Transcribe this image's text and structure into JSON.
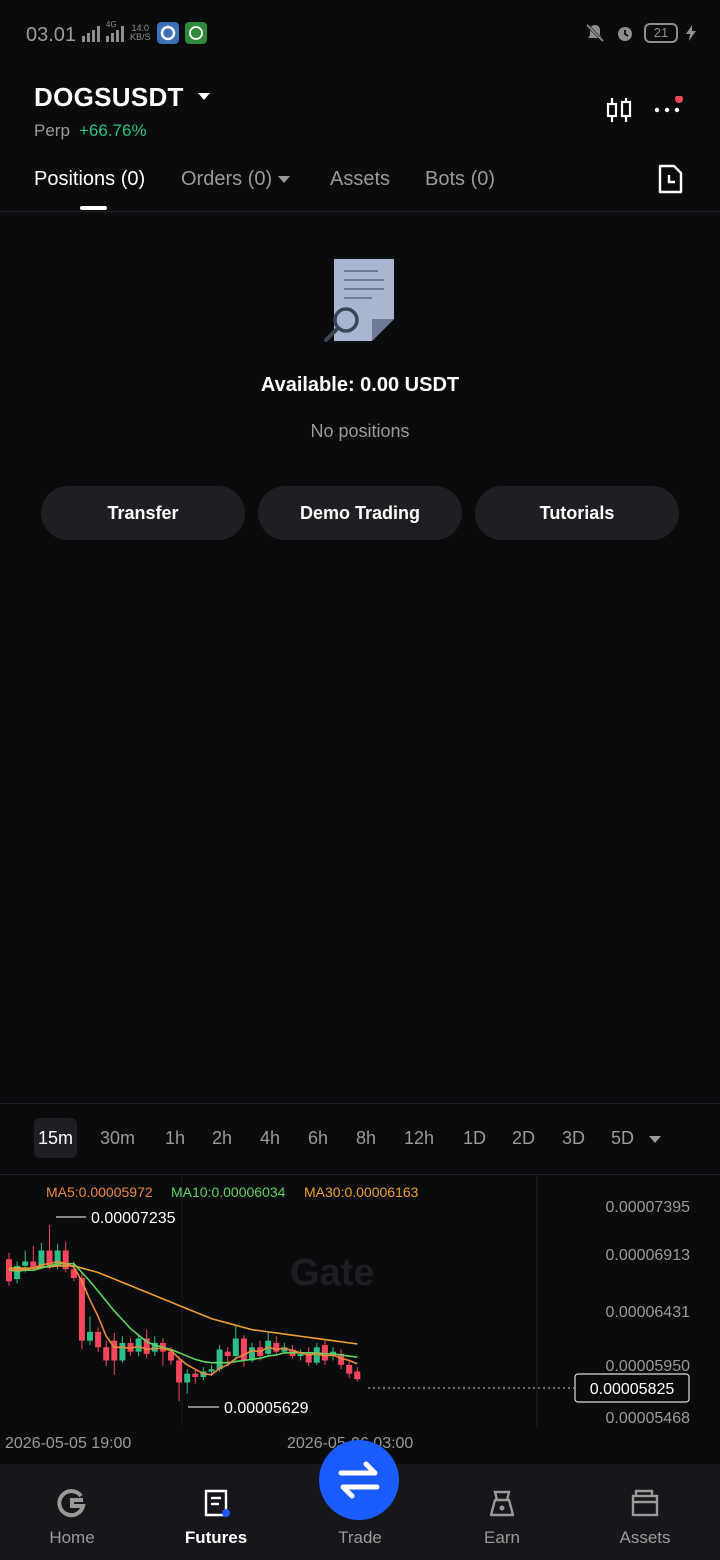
{
  "status_bar": {
    "time": "03.01",
    "net_speed_value": "14.0",
    "net_speed_unit": "KB/S",
    "battery": "21",
    "network_label": "4G"
  },
  "header": {
    "symbol": "DOGSUSDT",
    "contract_type": "Perp",
    "change": "+66.76%",
    "change_color": "#2ec27e",
    "icons": [
      "candlestick-icon",
      "more-icon",
      "history-icon"
    ]
  },
  "tabs": [
    {
      "label": "Positions (0)",
      "active": true
    },
    {
      "label": "Orders (0)",
      "active": false
    },
    {
      "label": "Assets",
      "active": false
    },
    {
      "label": "Bots (0)",
      "active": false
    }
  ],
  "empty_state": {
    "available": "Available: 0.00 USDT",
    "message": "No positions"
  },
  "actions": [
    {
      "label": "Transfer"
    },
    {
      "label": "Demo Trading"
    },
    {
      "label": "Tutorials"
    }
  ],
  "chart": {
    "intervals": [
      "15m",
      "30m",
      "1h",
      "2h",
      "4h",
      "6h",
      "8h",
      "12h",
      "1D",
      "2D",
      "3D",
      "5D"
    ],
    "active_interval": "15m",
    "ma5": "MA5:0.00005972",
    "ma10": "MA10:0.00006034",
    "ma30": "MA30:0.00006163",
    "ma5_color": "#f0883e",
    "ma10_color": "#5fd35f",
    "ma30_color": "#f0a030",
    "watermark": "Gate",
    "high_label": "0.00007235",
    "low_label": "0.00005629",
    "current_price": "0.00005825",
    "y_ticks": [
      "0.00007395",
      "0.00006913",
      "0.00006431",
      "0.00005950",
      "0.00005468"
    ],
    "x_ticks": [
      "2026-05-05 19:00",
      "2026-05-06 03:00"
    ],
    "up_color": "#2ebd85",
    "down_color": "#f6465d"
  },
  "chart_data": {
    "type": "candlestick",
    "ylim": [
      5.468e-05,
      7.395e-05
    ],
    "candles": [
      {
        "o": 6.92e-05,
        "c": 6.72e-05,
        "h": 6.98e-05,
        "l": 6.68e-05
      },
      {
        "o": 6.74e-05,
        "c": 6.86e-05,
        "h": 6.9e-05,
        "l": 6.7e-05
      },
      {
        "o": 6.86e-05,
        "c": 6.9e-05,
        "h": 7e-05,
        "l": 6.8e-05
      },
      {
        "o": 6.9e-05,
        "c": 6.85e-05,
        "h": 7.04e-05,
        "l": 6.82e-05
      },
      {
        "o": 6.85e-05,
        "c": 7e-05,
        "h": 7.07e-05,
        "l": 6.84e-05
      },
      {
        "o": 7e-05,
        "c": 6.86e-05,
        "h": 7.23e-05,
        "l": 6.83e-05
      },
      {
        "o": 6.86e-05,
        "c": 7e-05,
        "h": 7.06e-05,
        "l": 6.83e-05
      },
      {
        "o": 7e-05,
        "c": 6.83e-05,
        "h": 7.08e-05,
        "l": 6.8e-05
      },
      {
        "o": 6.83e-05,
        "c": 6.75e-05,
        "h": 6.9e-05,
        "l": 6.72e-05
      },
      {
        "o": 6.75e-05,
        "c": 6.18e-05,
        "h": 6.8e-05,
        "l": 6.1e-05
      },
      {
        "o": 6.18e-05,
        "c": 6.26e-05,
        "h": 6.4e-05,
        "l": 6.14e-05
      },
      {
        "o": 6.26e-05,
        "c": 6.12e-05,
        "h": 6.3e-05,
        "l": 6.08e-05
      },
      {
        "o": 6.12e-05,
        "c": 6e-05,
        "h": 6.18e-05,
        "l": 5.95e-05
      },
      {
        "o": 6.18e-05,
        "c": 6e-05,
        "h": 6.25e-05,
        "l": 5.87e-05
      },
      {
        "o": 6e-05,
        "c": 6.16e-05,
        "h": 6.22e-05,
        "l": 5.98e-05
      },
      {
        "o": 6.16e-05,
        "c": 6.08e-05,
        "h": 6.2e-05,
        "l": 6.04e-05
      },
      {
        "o": 6.08e-05,
        "c": 6.2e-05,
        "h": 6.24e-05,
        "l": 6.04e-05
      },
      {
        "o": 6.2e-05,
        "c": 6.06e-05,
        "h": 6.28e-05,
        "l": 6.02e-05
      },
      {
        "o": 6.08e-05,
        "c": 6.16e-05,
        "h": 6.22e-05,
        "l": 6.04e-05
      },
      {
        "o": 6.16e-05,
        "c": 6.08e-05,
        "h": 6.2e-05,
        "l": 5.95e-05
      },
      {
        "o": 6.08e-05,
        "c": 6e-05,
        "h": 6.12e-05,
        "l": 5.96e-05
      },
      {
        "o": 6e-05,
        "c": 5.8e-05,
        "h": 6.04e-05,
        "l": 5.63e-05
      },
      {
        "o": 5.8e-05,
        "c": 5.88e-05,
        "h": 5.92e-05,
        "l": 5.7e-05
      },
      {
        "o": 5.88e-05,
        "c": 5.85e-05,
        "h": 5.92e-05,
        "l": 5.79e-05
      },
      {
        "o": 5.85e-05,
        "c": 5.9e-05,
        "h": 5.94e-05,
        "l": 5.82e-05
      },
      {
        "o": 5.9e-05,
        "c": 5.92e-05,
        "h": 5.96e-05,
        "l": 5.86e-05
      },
      {
        "o": 5.92e-05,
        "c": 6.1e-05,
        "h": 6.14e-05,
        "l": 5.9e-05
      },
      {
        "o": 6.08e-05,
        "c": 6.04e-05,
        "h": 6.12e-05,
        "l": 5.96e-05
      },
      {
        "o": 6.04e-05,
        "c": 6.2e-05,
        "h": 6.32e-05,
        "l": 6e-05
      },
      {
        "o": 6.2e-05,
        "c": 6e-05,
        "h": 6.23e-05,
        "l": 5.94e-05
      },
      {
        "o": 6e-05,
        "c": 6.12e-05,
        "h": 6.16e-05,
        "l": 5.98e-05
      },
      {
        "o": 6.12e-05,
        "c": 6.04e-05,
        "h": 6.18e-05,
        "l": 6e-05
      },
      {
        "o": 6.06e-05,
        "c": 6.18e-05,
        "h": 6.26e-05,
        "l": 6.03e-05
      },
      {
        "o": 6.16e-05,
        "c": 6.08e-05,
        "h": 6.22e-05,
        "l": 6.04e-05
      },
      {
        "o": 6.08e-05,
        "c": 6.12e-05,
        "h": 6.16e-05,
        "l": 6.06e-05
      },
      {
        "o": 6.1e-05,
        "c": 6.04e-05,
        "h": 6.14e-05,
        "l": 6.02e-05
      },
      {
        "o": 6.04e-05,
        "c": 6.06e-05,
        "h": 6.1e-05,
        "l": 6e-05
      },
      {
        "o": 6.06e-05,
        "c": 5.98e-05,
        "h": 6.12e-05,
        "l": 5.95e-05
      },
      {
        "o": 5.98e-05,
        "c": 6.12e-05,
        "h": 6.16e-05,
        "l": 5.96e-05
      },
      {
        "o": 6.14e-05,
        "c": 6e-05,
        "h": 6.18e-05,
        "l": 5.96e-05
      },
      {
        "o": 6.04e-05,
        "c": 6.08e-05,
        "h": 6.12e-05,
        "l": 6e-05
      },
      {
        "o": 6.06e-05,
        "c": 5.96e-05,
        "h": 6.1e-05,
        "l": 5.92e-05
      },
      {
        "o": 5.96e-05,
        "c": 5.88e-05,
        "h": 6e-05,
        "l": 5.84e-05
      },
      {
        "o": 5.9e-05,
        "c": 5.83e-05,
        "h": 5.94e-05,
        "l": 5.81e-05
      }
    ],
    "ma5": [
      6.83e-05,
      6.82e-05,
      6.83e-05,
      6.84e-05,
      6.87e-05,
      6.88e-05,
      6.9e-05,
      6.88e-05,
      6.85e-05,
      6.72e-05,
      6.55e-05,
      6.4e-05,
      6.22e-05,
      6.12e-05,
      6.12e-05,
      6.11e-05,
      6.13e-05,
      6.1e-05,
      6.11e-05,
      6.11e-05,
      6.09e-05,
      6.02e-05,
      5.96e-05,
      5.92e-05,
      5.88e-05,
      5.87e-05,
      5.93e-05,
      5.96e-05,
      6.02e-05,
      6.05e-05,
      6.09e-05,
      6.08e-05,
      6.12e-05,
      6.1e-05,
      6.11e-05,
      6.09e-05,
      6.07e-05,
      6.05e-05,
      6.06e-05,
      6.04e-05,
      6.05e-05,
      6.02e-05,
      6e-05,
      5.97e-05
    ],
    "ma10": [
      6.82e-05,
      6.81e-05,
      6.82e-05,
      6.82e-05,
      6.84e-05,
      6.86e-05,
      6.88e-05,
      6.88e-05,
      6.88e-05,
      6.8e-05,
      6.72e-05,
      6.63e-05,
      6.54e-05,
      6.45e-05,
      6.37e-05,
      6.29e-05,
      6.23e-05,
      6.17e-05,
      6.14e-05,
      6.12e-05,
      6.1e-05,
      6.07e-05,
      6.04e-05,
      6.01e-05,
      5.99e-05,
      5.98e-05,
      5.98e-05,
      5.98e-05,
      5.99e-05,
      6e-05,
      6.01e-05,
      6.02e-05,
      6.04e-05,
      6.05e-05,
      6.07e-05,
      6.07e-05,
      6.07e-05,
      6.07e-05,
      6.07e-05,
      6.06e-05,
      6.06e-05,
      6.05e-05,
      6.04e-05,
      6.03e-05
    ],
    "ma30": [
      6.84e-05,
      6.84e-05,
      6.84e-05,
      6.84e-05,
      6.85e-05,
      6.85e-05,
      6.86e-05,
      6.86e-05,
      6.86e-05,
      6.84e-05,
      6.82e-05,
      6.8e-05,
      6.77e-05,
      6.74e-05,
      6.71e-05,
      6.68e-05,
      6.65e-05,
      6.62e-05,
      6.59e-05,
      6.56e-05,
      6.53e-05,
      6.5e-05,
      6.47e-05,
      6.44e-05,
      6.41e-05,
      6.38e-05,
      6.36e-05,
      6.34e-05,
      6.32e-05,
      6.3e-05,
      6.28e-05,
      6.27e-05,
      6.26e-05,
      6.25e-05,
      6.24e-05,
      6.23e-05,
      6.22e-05,
      6.21e-05,
      6.2e-05,
      6.19e-05,
      6.18e-05,
      6.17e-05,
      6.16e-05,
      6.15e-05
    ]
  },
  "bottom_nav": [
    {
      "label": "Home",
      "icon": "home-icon",
      "active": false
    },
    {
      "label": "Futures",
      "icon": "futures-icon",
      "active": true
    },
    {
      "label": "Trade",
      "icon": "trade-icon",
      "active": false
    },
    {
      "label": "Earn",
      "icon": "earn-icon",
      "active": false
    },
    {
      "label": "Assets",
      "icon": "assets-icon",
      "active": false
    }
  ]
}
